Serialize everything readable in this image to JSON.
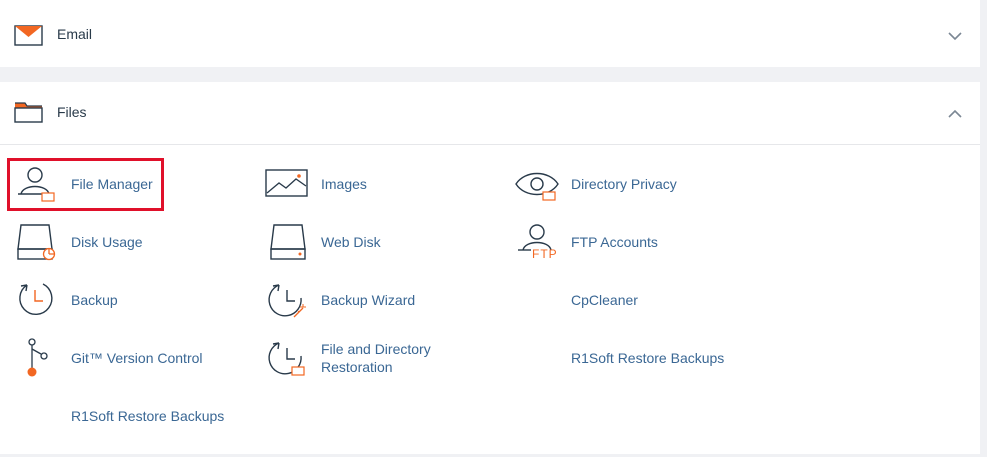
{
  "sections": {
    "email": {
      "title": "Email",
      "expanded": false,
      "chevron_icon": "chevron-down-icon"
    },
    "files": {
      "title": "Files",
      "expanded": true,
      "chevron_icon": "chevron-up-icon",
      "items": [
        {
          "id": "file-manager",
          "label": "File Manager",
          "icon": "file-manager-icon",
          "highlighted": true
        },
        {
          "id": "images",
          "label": "Images",
          "icon": "images-icon"
        },
        {
          "id": "directory-privacy",
          "label": "Directory Privacy",
          "icon": "directory-privacy-icon"
        },
        {
          "id": "disk-usage",
          "label": "Disk Usage",
          "icon": "disk-usage-icon"
        },
        {
          "id": "web-disk",
          "label": "Web Disk",
          "icon": "web-disk-icon"
        },
        {
          "id": "ftp-accounts",
          "label": "FTP Accounts",
          "icon": "ftp-accounts-icon",
          "icon_text": "FTP"
        },
        {
          "id": "backup",
          "label": "Backup",
          "icon": "backup-icon"
        },
        {
          "id": "backup-wizard",
          "label": "Backup Wizard",
          "icon": "backup-wizard-icon"
        },
        {
          "id": "cpcleaner",
          "label": "CpCleaner",
          "icon": ""
        },
        {
          "id": "git-version-control",
          "label": "Git™ Version Control",
          "icon": "git-icon"
        },
        {
          "id": "file-directory-restoration",
          "label_line1": "File and Directory",
          "label_line2": "Restoration",
          "icon": "restoration-icon"
        },
        {
          "id": "r1soft-restore-1",
          "label": "R1Soft Restore Backups",
          "icon": ""
        },
        {
          "id": "r1soft-restore-2",
          "label": "R1Soft Restore Backups",
          "icon": ""
        }
      ]
    }
  },
  "colors": {
    "accent": "#f26722",
    "icon_stroke": "#293a4a",
    "link": "#3a6794",
    "highlight_border": "#e0102a",
    "page_bg": "#f0f1f4"
  }
}
